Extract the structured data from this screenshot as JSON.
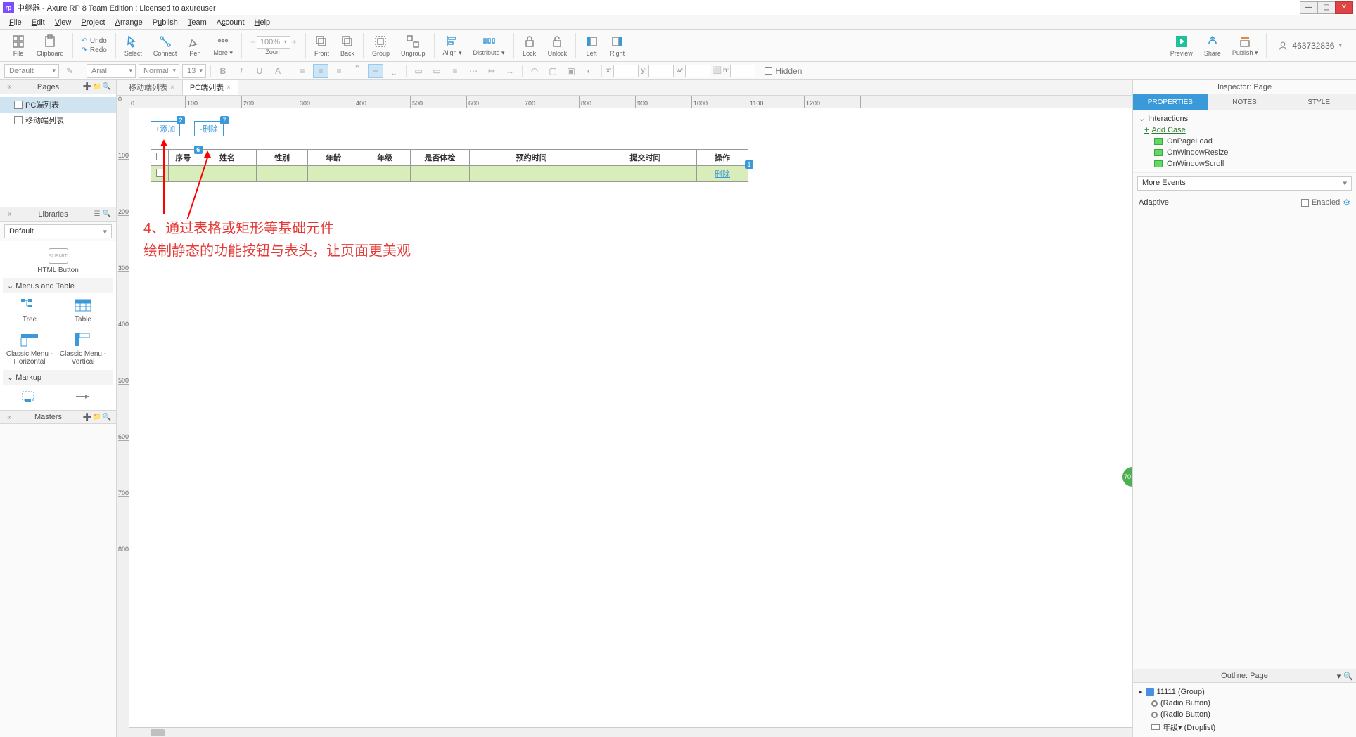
{
  "titlebar": {
    "appicon": "rp",
    "title": "中继器 - Axure RP 8 Team Edition : Licensed to axureuser"
  },
  "menus": [
    "File",
    "Edit",
    "View",
    "Project",
    "Arrange",
    "Publish",
    "Team",
    "Account",
    "Help"
  ],
  "toolbar": {
    "undo": "Undo",
    "redo": "Redo",
    "file": "File",
    "clipboard": "Clipboard",
    "select": "Select",
    "connect": "Connect",
    "pen": "Pen",
    "more": "More ▾",
    "zoom_value": "100%",
    "zoom": "Zoom",
    "front": "Front",
    "back": "Back",
    "group": "Group",
    "ungroup": "Ungroup",
    "align": "Align ▾",
    "distribute": "Distribute ▾",
    "lock": "Lock",
    "unlock": "Unlock",
    "left": "Left",
    "right": "Right",
    "preview": "Preview",
    "share": "Share",
    "publish": "Publish ▾",
    "user": "463732836"
  },
  "format": {
    "style_preset": "Default",
    "font": "Arial",
    "weight": "Normal",
    "size": "13",
    "xlabel": "x:",
    "ylabel": "y:",
    "wlabel": "w:",
    "hlabel": "h:",
    "hidden": "Hidden"
  },
  "left": {
    "pages_title": "Pages",
    "pages": [
      "PC端列表",
      "移动端列表"
    ],
    "libraries_title": "Libraries",
    "library_selected": "Default",
    "html_button": "HTML Button",
    "section_menus": "Menus and Table",
    "section_markup": "Markup",
    "items": {
      "tree": "Tree",
      "table": "Table",
      "cmh": "Classic Menu - Horizontal",
      "cmv": "Classic Menu - Vertical"
    },
    "masters_title": "Masters"
  },
  "tabs": [
    "移动端列表",
    "PC端列表"
  ],
  "canvas": {
    "btn_add": "+添加",
    "badge_add": "2",
    "btn_del": "-删除",
    "badge_del": "7",
    "headers": [
      "序号",
      "姓名",
      "性别",
      "年龄",
      "年级",
      "是否体检",
      "预约时间",
      "提交时间",
      "操作"
    ],
    "row_del": "删除",
    "row_badge": "1",
    "annotation": "4、通过表格或矩形等基础元件\n绘制静态的功能按钮与表头，让页面更美观"
  },
  "ruler_ticks": [
    "0",
    "100",
    "200",
    "300",
    "400",
    "500",
    "600",
    "700",
    "800",
    "900",
    "1000",
    "1100",
    "1200"
  ],
  "vruler_ticks": [
    "0",
    "100",
    "200",
    "300",
    "400",
    "500",
    "600",
    "700",
    "800"
  ],
  "inspector": {
    "title": "Inspector: Page",
    "tabs": [
      "PROPERTIES",
      "NOTES",
      "STYLE"
    ],
    "interactions": "Interactions",
    "add_case": "Add Case",
    "events": [
      "OnPageLoad",
      "OnWindowResize",
      "OnWindowScroll"
    ],
    "more_events": "More Events",
    "adaptive": "Adaptive",
    "enabled": "Enabled"
  },
  "outline": {
    "title": "Outline: Page",
    "root": "11111 (Group)",
    "children": [
      "(Radio Button)",
      "(Radio Button)",
      "年级▾ (Droplist)"
    ]
  }
}
